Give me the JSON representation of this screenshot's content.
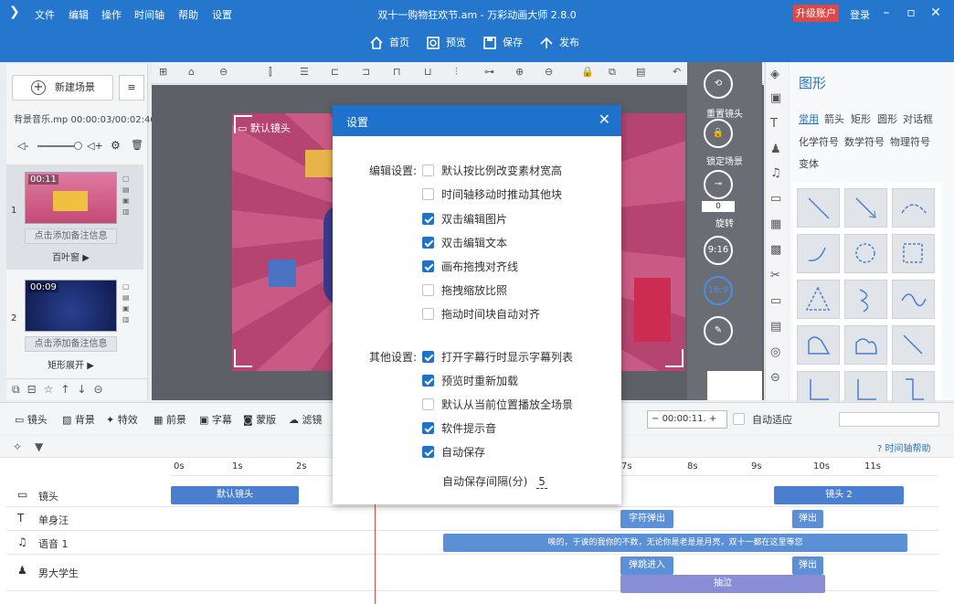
{
  "menu": {
    "file": "文件",
    "edit": "编辑",
    "operate": "操作",
    "timeline": "时间轴",
    "help": "帮助",
    "settings": "设置"
  },
  "app_title": "双十一购物狂欢节.am - 万彩动画大师 2.8.0",
  "header": {
    "upgrade": "升级账户",
    "login": "登录"
  },
  "toolbar": {
    "home": "首页",
    "preview": "预览",
    "save": "保存",
    "publish": "发布"
  },
  "left": {
    "new_scene": "新建场景",
    "music": "背景音乐.mp",
    "music_time": "00:00:03/00:02:46",
    "scenes": [
      {
        "num": "1",
        "duration": "00:11",
        "note": "点击添加备注信息",
        "name": "百叶窗"
      },
      {
        "num": "2",
        "duration": "00:09",
        "note": "点击添加备注信息",
        "name": "矩形展开"
      }
    ]
  },
  "stage": {
    "camera_label": "默认镜头"
  },
  "canvas_right": {
    "reset_camera": "重置镜头",
    "lock_scene": "锁定场景",
    "rotate": "旋转",
    "rotate_value": "0",
    "ratio_916": "9:16",
    "ratio_169": "16:9"
  },
  "shape_panel": {
    "title": "图形",
    "categories": [
      "常用",
      "箭头",
      "矩形",
      "圆形",
      "对话框",
      "化学符号",
      "数学符号",
      "物理符号",
      "变体"
    ]
  },
  "bottom": {
    "camera": "镜头",
    "background": "背景",
    "effect": "特效",
    "foreground": "前景",
    "subtitle": "字幕",
    "mask": "蒙版",
    "filter": "滤镜",
    "time": "00:00:11.",
    "auto_fit": "自动适应",
    "help": "时间轴帮助"
  },
  "ruler": [
    "0s",
    "1s",
    "2s",
    "7s",
    "8s",
    "9s",
    "10s",
    "11s"
  ],
  "tracks": [
    {
      "name": "镜头"
    },
    {
      "name": "单身汪"
    },
    {
      "name": "语音 1"
    },
    {
      "name": "男大学生"
    }
  ],
  "clips": {
    "default_camera": "默认镜头",
    "camera2": "镜头 2",
    "char_in": "字符弹出",
    "pop_out": "弹出",
    "pop_out2": "弹出",
    "bounce_in": "弹跳进入",
    "pop_out3": "弹出",
    "shake": "抽泣",
    "audio_text": "唉的，于诶的我你的不数，无论你是老是是月亮，双十一都在这里等您"
  },
  "dialog": {
    "title": "设置",
    "edit_group": "编辑设置:",
    "edit_options": [
      {
        "label": "默认按比例改变素材宽高",
        "checked": false
      },
      {
        "label": "时间轴移动时推动其他块",
        "checked": false
      },
      {
        "label": "双击编辑图片",
        "checked": true
      },
      {
        "label": "双击编辑文本",
        "checked": true
      },
      {
        "label": "画布拖拽对齐线",
        "checked": true
      },
      {
        "label": "拖拽缩放比照",
        "checked": false
      },
      {
        "label": "拖动时间块自动对齐",
        "checked": false
      }
    ],
    "other_group": "其他设置:",
    "other_options": [
      {
        "label": "打开字幕行时显示字幕列表",
        "checked": true
      },
      {
        "label": "预览时重新加载",
        "checked": true
      },
      {
        "label": "默认从当前位置播放全场景",
        "checked": false
      },
      {
        "label": "软件提示音",
        "checked": true
      },
      {
        "label": "自动保存",
        "checked": true
      }
    ],
    "autosave_label": "自动保存间隔(分)",
    "autosave_value": "5"
  }
}
